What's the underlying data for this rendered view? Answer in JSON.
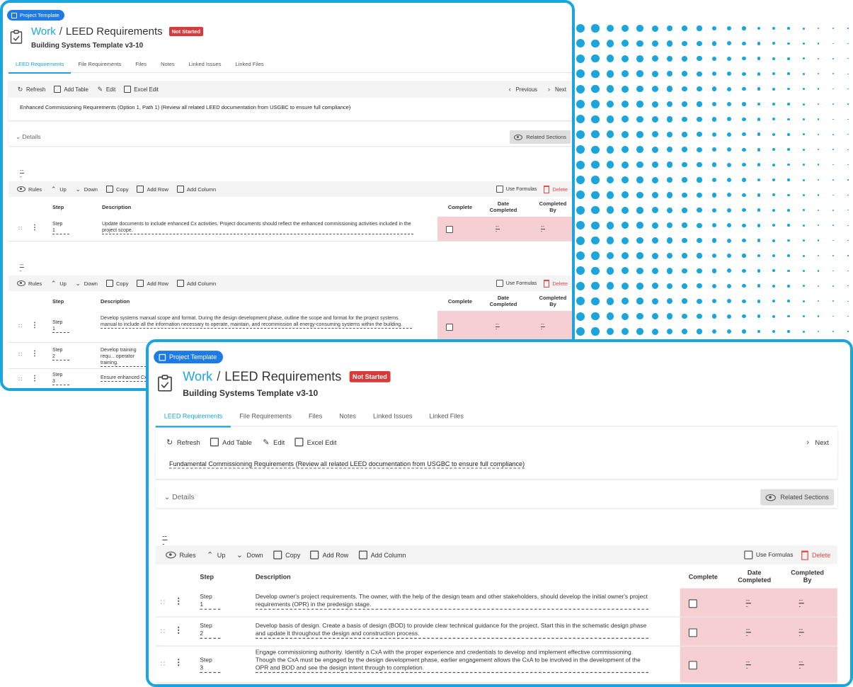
{
  "colors": {
    "accent": "#1aa6dd",
    "badge_blue": "#1e7be6",
    "not_started_red": "#d83a3a",
    "pink_cell": "#f6cfd2",
    "delete_red": "#e44444"
  },
  "back_window": {
    "badge": "Project Template",
    "title_work": "Work",
    "title_sep": "/",
    "title_main": "LEED Requirements",
    "status": "Not Started",
    "subtitle": "Building Systems Template v3-10",
    "tabs": [
      "LEED Requirements",
      "File Requirements",
      "Files",
      "Notes",
      "Linked Issues",
      "Linked Files"
    ],
    "toolbar": {
      "refresh": "Refresh",
      "add_table": "Add Table",
      "edit": "Edit",
      "excel_edit": "Excel Edit",
      "previous": "Previous",
      "next": "Next"
    },
    "description": "Enhanced Commissioning Requirements (Option 1, Path 1) (Review all related LEED documentation from USGBC to ensure full compliance)",
    "details": "Details",
    "related_sections": "Related Sections",
    "table_tools": {
      "rules": "Rules",
      "up": "Up",
      "down": "Down",
      "copy": "Copy",
      "add_row": "Add Row",
      "add_column": "Add Column",
      "use_formulas": "Use Formulas",
      "delete": "Delete"
    },
    "columns": {
      "step": "Step",
      "description": "Description",
      "complete": "Complete",
      "date_completed": "Date Completed",
      "completed_by": "Completed By"
    },
    "table1_name": "---",
    "table1_rows": [
      {
        "step": "Step 1",
        "description": "Update documents to include enhanced Cx activities. Project documents should reflect the enhanced commissioning activities included in the project scope.",
        "date": "---",
        "by": "---"
      }
    ],
    "table2_name": "---",
    "table2_rows": [
      {
        "step": "Step 1",
        "description": "Develop systems manual scope and format. During the design development phase, outline the scope and format for the project systems manual to include all the information necessary to operate, maintain, and recommission all energy-consuming systems within the building.",
        "date": "---",
        "by": "---"
      },
      {
        "step": "Step 2",
        "description": "Develop training requ... operator training.",
        "date": "---",
        "by": "---"
      },
      {
        "step": "Step 3",
        "description": "Ensure enhanced Cx",
        "date": "---",
        "by": "---"
      }
    ]
  },
  "front_window": {
    "badge": "Project Template",
    "title_work": "Work",
    "title_sep": "/",
    "title_main": "LEED Requirements",
    "status": "Not Started",
    "subtitle": "Building Systems Template v3-10",
    "tabs": [
      "LEED Requirements",
      "File Requirements",
      "Files",
      "Notes",
      "Linked Issues",
      "Linked Files"
    ],
    "toolbar": {
      "refresh": "Refresh",
      "add_table": "Add Table",
      "edit": "Edit",
      "excel_edit": "Excel Edit",
      "next": "Next"
    },
    "description": "Fundamental Commissioning Requirements (Review all related LEED documentation from USGBC to ensure full compliance)",
    "details": "Details",
    "related_sections": "Related Sections",
    "table_tools": {
      "rules": "Rules",
      "up": "Up",
      "down": "Down",
      "copy": "Copy",
      "add_row": "Add Row",
      "add_column": "Add Column",
      "use_formulas": "Use Formulas",
      "delete": "Delete"
    },
    "columns": {
      "step": "Step",
      "description": "Description",
      "complete": "Complete",
      "date_completed": "Date Completed",
      "completed_by": "Completed By"
    },
    "table1_name": "---",
    "table1_rows": [
      {
        "step": "Step 1",
        "description": "Develop owner's project requirements. The owner, with the help of the design team and other stakeholders, should develop the initial owner's project requirements (OPR) in the predesign stage.",
        "date": "---",
        "by": "---"
      },
      {
        "step": "Step 2",
        "description": "Develop basis of design. Create a basis of design (BOD) to provide clear technical guidance for the project. Start this in the schematic design phase and update it throughout the design and construction process.",
        "date": "---",
        "by": "---"
      },
      {
        "step": "Step 3",
        "description": "Engage commissioning authority. Identify a CxA with the proper experience and credentials to develop and implement effective commissioning. Though the CxA must be engaged by the design development phase, earlier engagement allows the CxA to be involved in the development of the OPR and BOD and see the design intent through to completion.",
        "date": "---",
        "by": "---"
      }
    ]
  }
}
